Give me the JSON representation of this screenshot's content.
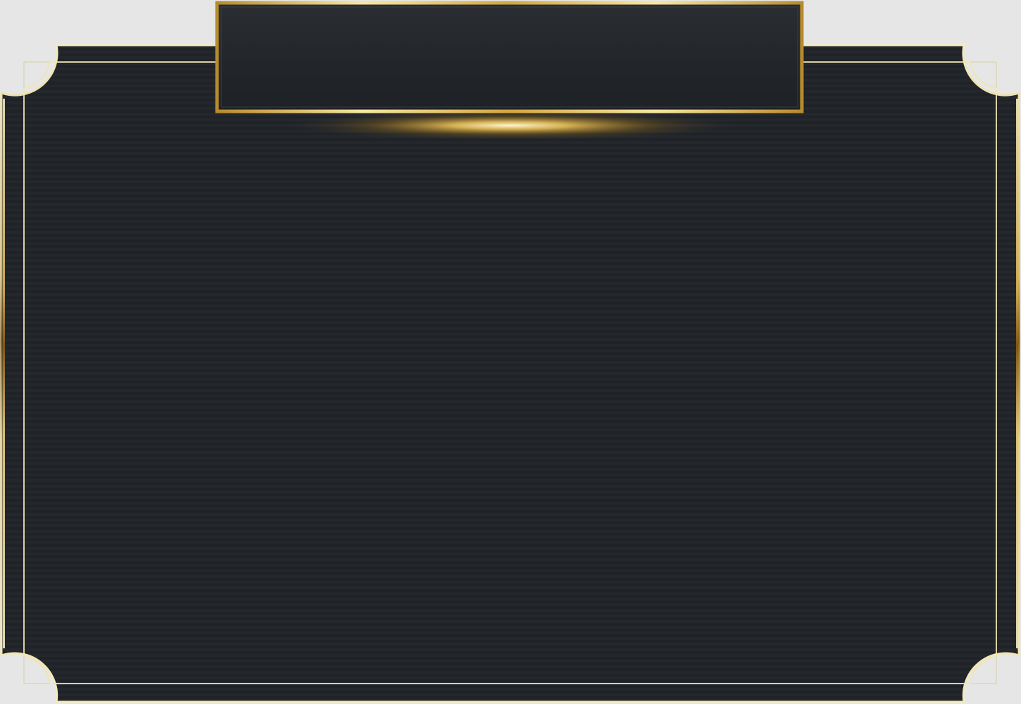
{
  "frame": {
    "title": "",
    "body": "",
    "colors": {
      "background": "#e6e6e6",
      "panel": "#23272c",
      "panel_dark": "#1c1f23",
      "gold": "#d9b24a",
      "gold_light": "#f4e6a8",
      "gold_dark": "#8a6a1c"
    },
    "decorations": [
      "glow-highlight",
      "corner-notch",
      "stripe-texture",
      "inner-border"
    ]
  }
}
